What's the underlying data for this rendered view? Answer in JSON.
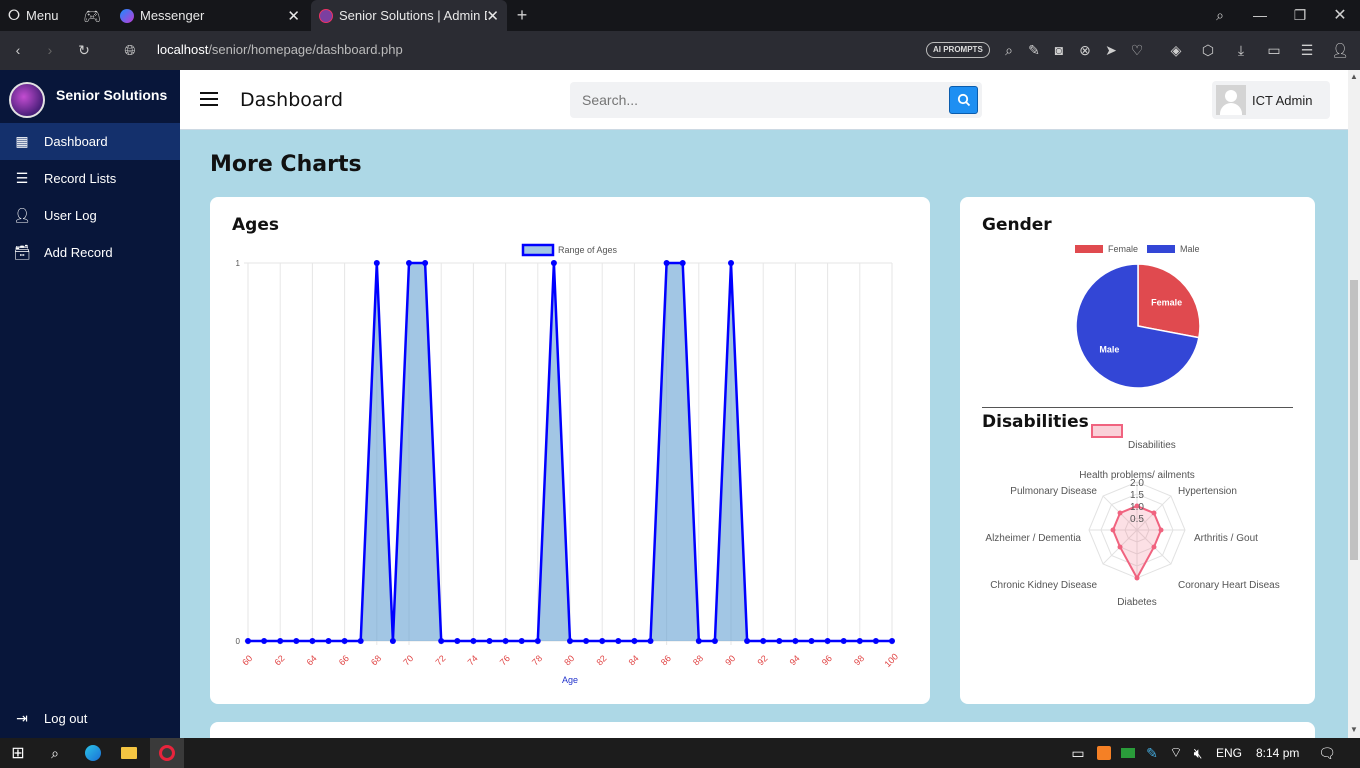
{
  "browser": {
    "menu_label": "Menu",
    "tabs": [
      {
        "label": "Messenger"
      },
      {
        "label": "Senior Solutions | Admin Da"
      }
    ],
    "url_host": "localhost",
    "url_path": "/senior/homepage/dashboard.php",
    "ai_prompts": "AI PROMPTS"
  },
  "sidebar": {
    "brand": "Senior Solutions",
    "items": [
      {
        "label": "Dashboard",
        "icon": "grid-icon"
      },
      {
        "label": "Record Lists",
        "icon": "list-icon"
      },
      {
        "label": "User Log",
        "icon": "user-icon"
      },
      {
        "label": "Add Record",
        "icon": "archive-icon"
      }
    ],
    "logout": "Log out"
  },
  "header": {
    "title": "Dashboard",
    "search_placeholder": "Search...",
    "user_name": "ICT Admin"
  },
  "main": {
    "section_title": "More Charts",
    "ages_title": "Ages",
    "gender_title": "Gender",
    "disabilities_title": "Disabilities"
  },
  "taskbar": {
    "lang": "ENG",
    "time": "8:14 pm"
  },
  "colors": {
    "sidebar_bg": "#08163a",
    "page_bg": "#add8e6",
    "line_blue": "#0000ff",
    "female_red": "#e04a4f",
    "male_blue": "#3346d6",
    "radar_pink": "#f0637f"
  },
  "chart_data": [
    {
      "type": "area",
      "title": "Ages",
      "legend": [
        "Range of Ages"
      ],
      "xlabel": "Age",
      "ylabel": "",
      "x": [
        60,
        61,
        62,
        63,
        64,
        65,
        66,
        67,
        68,
        69,
        70,
        71,
        72,
        73,
        74,
        75,
        76,
        77,
        78,
        79,
        80,
        81,
        82,
        83,
        84,
        85,
        86,
        87,
        88,
        89,
        90,
        91,
        92,
        93,
        94,
        95,
        96,
        97,
        98,
        99,
        100
      ],
      "series": [
        {
          "name": "Range of Ages",
          "values": [
            0,
            0,
            0,
            0,
            0,
            0,
            0,
            0,
            1,
            0,
            1,
            1,
            0,
            0,
            0,
            0,
            0,
            0,
            0,
            1,
            0,
            0,
            0,
            0,
            0,
            0,
            1,
            1,
            0,
            0,
            1,
            0,
            0,
            0,
            0,
            0,
            0,
            0,
            0,
            0,
            0
          ]
        }
      ],
      "x_tick_labels": [
        "60",
        "62",
        "64",
        "66",
        "68",
        "70",
        "72",
        "74",
        "76",
        "78",
        "80",
        "82",
        "84",
        "86",
        "88",
        "90",
        "92",
        "94",
        "96",
        "98",
        "100"
      ],
      "y_tick_labels": [
        "0",
        "1"
      ],
      "ylim": [
        0,
        1
      ],
      "grid": true,
      "legend_position": "top"
    },
    {
      "type": "pie",
      "title": "Gender",
      "categories": [
        "Female",
        "Male"
      ],
      "values": [
        28,
        72
      ],
      "legend_position": "top"
    },
    {
      "type": "radar",
      "title": "Disabilities",
      "legend": [
        "Disabilities"
      ],
      "categories": [
        "Health problems/ ailments",
        "Hypertension",
        "Arthritis / Gout",
        "Coronary Heart Diseas",
        "Diabetes",
        "Chronic Kidney Disease",
        "Alzheimer / Dementia",
        "Pulmonary Disease"
      ],
      "series": [
        {
          "name": "Disabilities",
          "values": [
            1,
            1,
            1,
            1,
            2,
            1,
            1,
            1
          ]
        }
      ],
      "r_tick_labels": [
        "0.5",
        "1.0",
        "1.5",
        "2.0"
      ],
      "rlim": [
        0,
        2
      ],
      "legend_position": "top"
    }
  ]
}
